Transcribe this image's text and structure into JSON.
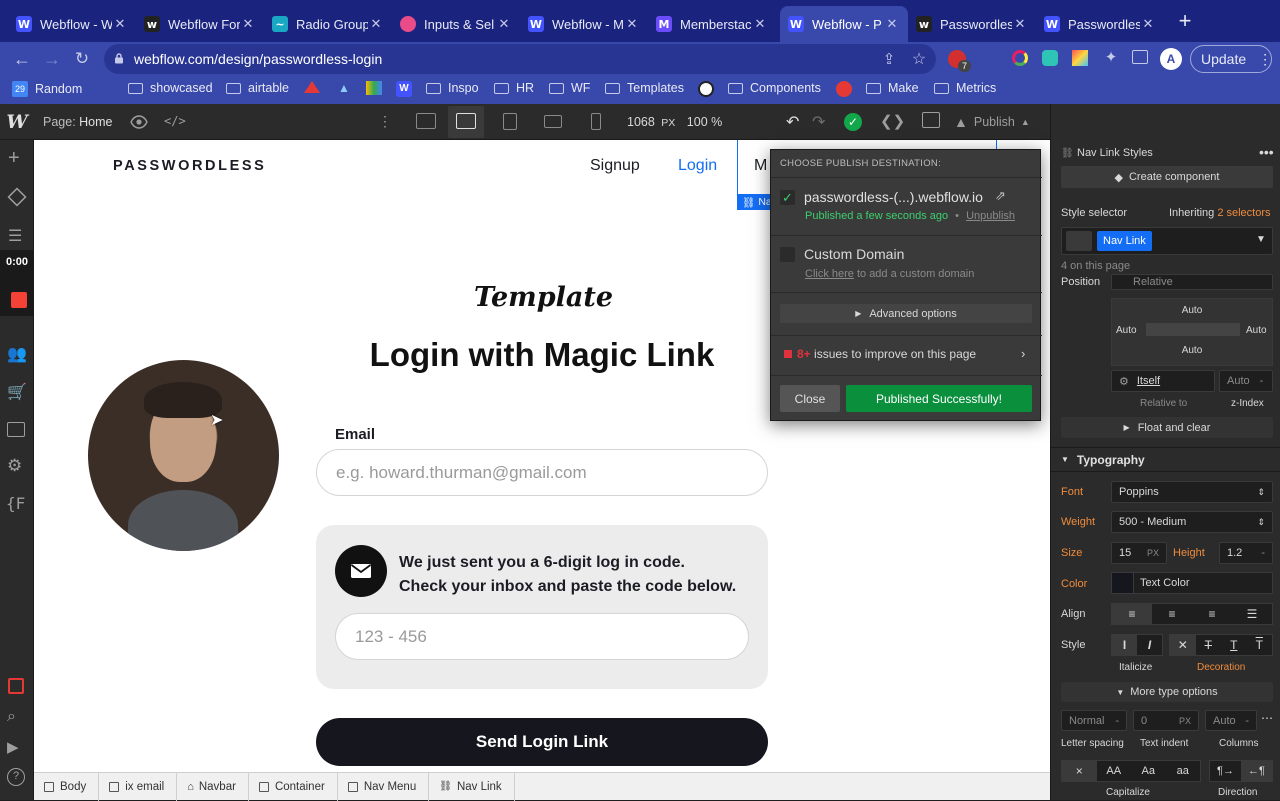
{
  "browser": {
    "tabs": [
      {
        "label": "Webflow - W",
        "favicon": "W",
        "color": "#4353ff"
      },
      {
        "label": "Webflow For",
        "favicon": "w",
        "color": "#222222"
      },
      {
        "label": "Radio Group",
        "favicon": "~",
        "color": "#1aa7c4"
      },
      {
        "label": "Inputs & Sel",
        "favicon": "●",
        "color": "#ea4c89"
      },
      {
        "label": "Webflow - M",
        "favicon": "W",
        "color": "#4353ff"
      },
      {
        "label": "Memberstac",
        "favicon": "M",
        "color": "#6b4cff"
      },
      {
        "label": "Webflow - P",
        "favicon": "W",
        "color": "#4353ff"
      },
      {
        "label": "Passwordles",
        "favicon": "w",
        "color": "#222222"
      },
      {
        "label": "Passwordles",
        "favicon": "W",
        "color": "#4353ff"
      }
    ],
    "new_tab": "+",
    "url": "webflow.com/design/passwordless-login",
    "update_label": "Update",
    "extension_badge": "7",
    "bookmarks": [
      "Random",
      "showcased",
      "airtable",
      "Inspo",
      "HR",
      "WF",
      "Templates",
      "Components",
      "Make",
      "Metrics"
    ],
    "calendar_day": "29"
  },
  "designer": {
    "page_prefix": "Page:",
    "page_name": "Home",
    "width_value": "1068",
    "width_unit": "PX",
    "zoom": "100 %",
    "publish_label": "Publish",
    "timer": "0:00"
  },
  "site": {
    "brand": "PASSWORDLESS",
    "nav": {
      "signup": "Signup",
      "login": "Login",
      "more": "M",
      "selected_tag": "Na"
    },
    "template_label": "Template",
    "heading": "Login with Magic Link",
    "email_label": "Email",
    "email_placeholder": "e.g. howard.thurman@gmail.com",
    "code_message_line1": "We just sent you a 6-digit log in code.",
    "code_message_line2": "Check your inbox and paste the code below.",
    "code_placeholder": "123 - 456",
    "send_button": "Send Login Link"
  },
  "publish_popup": {
    "header": "CHOOSE PUBLISH DESTINATION:",
    "staging_domain": "passwordless-(...).webflow.io",
    "published_status": "Published a few seconds ago",
    "separator": "•",
    "unpublish": "Unpublish",
    "custom_domain": "Custom Domain",
    "click_here": "Click here",
    "custom_domain_hint": " to add a custom domain",
    "advanced_options": "Advanced options",
    "issues_count": "8+",
    "issues_text": " issues to improve on this page",
    "close_button": "Close",
    "published_button": "Published Successfully!"
  },
  "style_panel": {
    "element_label": "Nav Link Styles",
    "create_component": "Create component",
    "style_selector": "Style selector",
    "inheriting_prefix": "Inheriting ",
    "inheriting_count": "2 selectors",
    "selector_chip": "Nav Link",
    "on_page": "4 on this page",
    "position_label": "Position",
    "position_value": "Relative",
    "auto": "Auto",
    "relative_to_value": "Itself",
    "relative_to_label": "Relative to",
    "zindex_value": "Auto",
    "zindex_label": "z-Index",
    "float_clear": "Float and clear",
    "typography": "Typography",
    "font_label": "Font",
    "font_value": "Poppins",
    "weight_label": "Weight",
    "weight_value": "500 - Medium",
    "size_label": "Size",
    "size_value": "15",
    "size_unit": "PX",
    "height_label": "Height",
    "height_value": "1.2",
    "height_unit": "-",
    "color_label": "Color",
    "color_value": "Text Color",
    "align_label": "Align",
    "style_label": "Style",
    "italicize": "Italicize",
    "decoration": "Decoration",
    "more_type": "More type options",
    "letter_spacing_value": "Normal",
    "letter_spacing_unit": "-",
    "letter_spacing_label": "Letter spacing",
    "text_indent_value": "0",
    "text_indent_unit": "PX",
    "text_indent_label": "Text indent",
    "columns_value": "Auto",
    "columns_unit": "-",
    "columns_label": "Columns",
    "capitalize_label": "Capitalize",
    "direction_label": "Direction",
    "case_options": [
      "×",
      "AA",
      "Aa",
      "aa"
    ]
  },
  "breadcrumb": [
    "Body",
    "ix email",
    "Navbar",
    "Container",
    "Nav Menu",
    "Nav Link"
  ],
  "colors": {
    "accent_blue": "#146ef5",
    "publish_green": "#0a8f3d",
    "orange": "#f08c3c",
    "issue_red": "#e0323c"
  }
}
